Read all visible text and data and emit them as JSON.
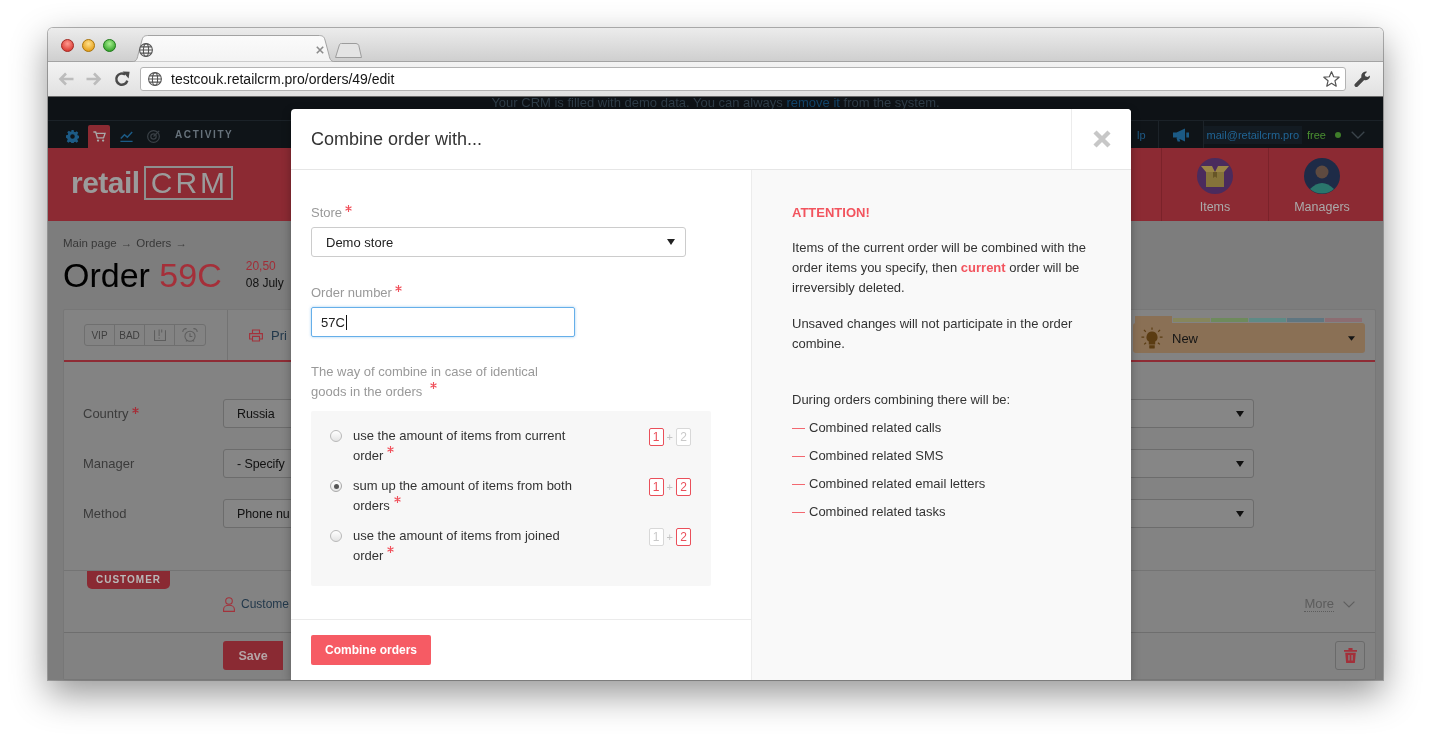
{
  "browser": {
    "nav_buttons": [
      {
        "kind": "back",
        "disabled": true
      },
      {
        "kind": "forward",
        "disabled": true
      },
      {
        "kind": "reload",
        "disabled": false
      }
    ],
    "url": "testcouk.retailcrm.pro/orders/49/edit",
    "bookmarked": false
  },
  "demo_banner": {
    "text": "Your CRM is filled with demo data. You can always",
    "link": "remove it",
    "text_end": "from the system."
  },
  "top_nav": {
    "icons": [
      {
        "kind": "settings",
        "selected": false
      },
      {
        "kind": "cart",
        "selected": true
      },
      {
        "kind": "chart",
        "selected": false
      },
      {
        "kind": "target",
        "selected": false
      }
    ],
    "section": "ACTIVITY",
    "help": "lp",
    "user_email": "mail@retailcrm.pro",
    "plan": "free",
    "online": true
  },
  "header": {
    "logo": {
      "text": "retail",
      "mark": "CRM"
    },
    "links": [
      {
        "kind": "items",
        "label": "Items"
      },
      {
        "kind": "managers",
        "label": "Managers"
      }
    ]
  },
  "order": {
    "breadcrumbs": [
      {
        "text": "Main page",
        "separator": "→"
      },
      {
        "text": "Orders",
        "separator": "→"
      }
    ],
    "title": "Order",
    "number": "59C",
    "total": "20,50",
    "date": "08 July"
  },
  "order_toolbar": {
    "tags": [
      {
        "kind": "text",
        "label": "VIP"
      },
      {
        "kind": "text",
        "label": "BAD"
      },
      {
        "kind": "exclamation"
      },
      {
        "kind": "alarm"
      }
    ],
    "print": "Pri",
    "status": {
      "label": "New",
      "strip": [
        {
          "color": "#8a7055",
          "selected": true
        },
        {
          "color": "#86865c",
          "selected": false
        },
        {
          "color": "#6e8a5c",
          "selected": false
        },
        {
          "color": "#5e8a86",
          "selected": false
        },
        {
          "color": "#5f7681",
          "selected": false
        },
        {
          "color": "#8c6d72",
          "selected": false
        }
      ]
    }
  },
  "form": [
    {
      "label": "Country",
      "required": true,
      "value": "Russia"
    },
    {
      "label": "Manager",
      "required": false,
      "value": "- Specify"
    },
    {
      "label": "Method",
      "required": false,
      "value": "Phone nu"
    }
  ],
  "customer": {
    "tag": "CUSTOMER",
    "name": "Custome",
    "more": "More"
  },
  "bottom_bar": {
    "save": "Save"
  },
  "modal": {
    "title": "Combine order with...",
    "store": {
      "label": "Store",
      "required": true,
      "value": "Demo store"
    },
    "order_number": {
      "label": "Order number",
      "required": true,
      "value": "57C",
      "focused": true
    },
    "combine_way": {
      "label": "The way of combine in case of identical goods in the orders",
      "required": true,
      "options": [
        {
          "label": "use the amount of items from current order",
          "required": true,
          "selected": false,
          "badges": [
            {
              "text": "1",
              "active": true
            },
            {
              "text": "2",
              "active": false
            }
          ],
          "plus": "+"
        },
        {
          "label": "sum up the amount of items from both orders",
          "required": true,
          "selected": true,
          "badges": [
            {
              "text": "1",
              "active": true
            },
            {
              "text": "2",
              "active": true
            }
          ],
          "plus": "+"
        },
        {
          "label": "use the amount of items from joined order",
          "required": true,
          "selected": false,
          "badges": [
            {
              "text": "1",
              "active": false
            },
            {
              "text": "2",
              "active": true
            }
          ],
          "plus": "+"
        }
      ]
    },
    "submit": "Combine orders",
    "info": {
      "heading": "ATTENTION!",
      "paragraphs": [
        "Items of the current order will be combined with the order items you specify, then **current** order will be irreversibly deleted.",
        "Unsaved changes will not participate in the order combine."
      ],
      "list_intro": "During orders combining there will be:",
      "list": [
        {
          "bullet": "—",
          "text": "Combined related calls"
        },
        {
          "bullet": "—",
          "text": "Combined related SMS"
        },
        {
          "bullet": "—",
          "text": "Combined related email letters"
        },
        {
          "bullet": "—",
          "text": "Combined related tasks"
        }
      ]
    }
  }
}
